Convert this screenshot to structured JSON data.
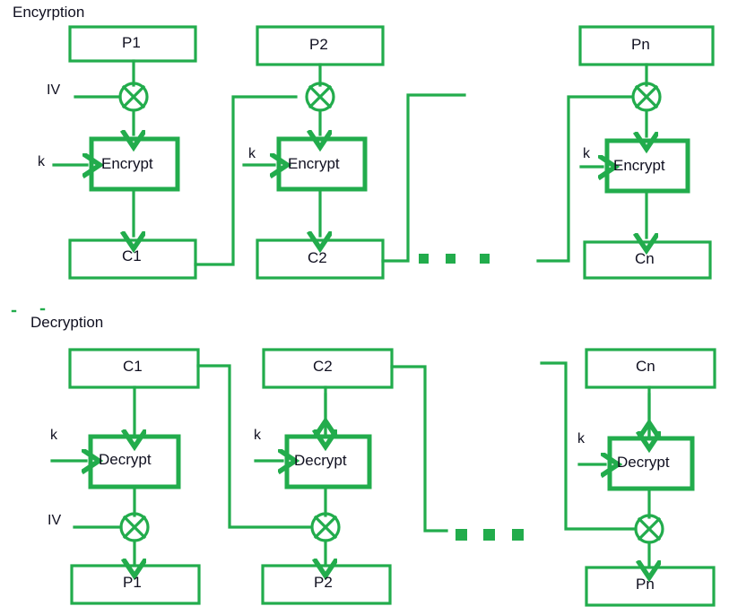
{
  "meta": {
    "diagram_title": "CBC (Cipher Block Chaining) mode encryption and decryption",
    "accent_color": "#22AC4C",
    "text_color": "#101020",
    "background": "#FFFFFF"
  },
  "sections": [
    {
      "id": "encryption",
      "title": "Encyrption"
    },
    {
      "id": "decryption",
      "title": "Decryption"
    }
  ],
  "encryption": {
    "title": "Encyrption",
    "columns": [
      {
        "id": "enc-col-1",
        "input_block": "P1",
        "iv_label": "IV",
        "key_label": "k",
        "cipher_op": "Encrypt",
        "output_block": "C1",
        "xor_symbol": "⊕"
      },
      {
        "id": "enc-col-2",
        "input_block": "P2",
        "iv_label": "",
        "key_label": "k",
        "cipher_op": "Encrypt",
        "output_block": "C2",
        "xor_symbol": "⊕"
      },
      {
        "id": "enc-col-n",
        "input_block": "Pn",
        "iv_label": "",
        "key_label": "k",
        "cipher_op": "Encrypt",
        "output_block": "Cn",
        "xor_symbol": "⊕"
      }
    ],
    "ellipsis_dots": 3
  },
  "decryption": {
    "title": "Decryption",
    "columns": [
      {
        "id": "dec-col-1",
        "input_block": "C1",
        "key_label": "k",
        "cipher_op": "Decrypt",
        "iv_label": "IV",
        "output_block": "P1",
        "xor_symbol": "⊕"
      },
      {
        "id": "dec-col-2",
        "input_block": "C2",
        "key_label": "k",
        "cipher_op": "Decrypt",
        "iv_label": "",
        "output_block": "P2",
        "xor_symbol": "⊕"
      },
      {
        "id": "dec-col-n",
        "input_block": "Cn",
        "key_label": "k",
        "cipher_op": "Decrypt",
        "iv_label": "",
        "output_block": "Pn",
        "xor_symbol": "⊕"
      }
    ],
    "ellipsis_dots": 3
  }
}
